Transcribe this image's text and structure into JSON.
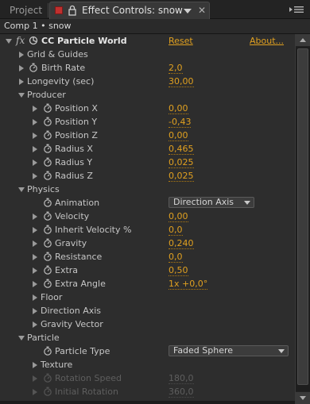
{
  "tabs": {
    "project_label": "Project",
    "effect_controls_label": "Effect Controls: snow"
  },
  "comp_path": "Comp 1 • snow",
  "effect": {
    "fx_symbol": "fx",
    "name": "CC Particle World",
    "reset_label": "Reset",
    "about_label": "About..."
  },
  "rows": {
    "grid_guides": "Grid & Guides",
    "birth_rate": {
      "label": "Birth Rate",
      "value": "2,0"
    },
    "longevity": {
      "label": "Longevity (sec)",
      "value": "30,00"
    },
    "producer": "Producer",
    "position_x": {
      "label": "Position X",
      "value": "0,00"
    },
    "position_y": {
      "label": "Position Y",
      "value": "-0,43"
    },
    "position_z": {
      "label": "Position Z",
      "value": "0,00"
    },
    "radius_x": {
      "label": "Radius X",
      "value": "0,465"
    },
    "radius_y": {
      "label": "Radius Y",
      "value": "0,025"
    },
    "radius_z": {
      "label": "Radius Z",
      "value": "0,025"
    },
    "physics": "Physics",
    "animation": {
      "label": "Animation",
      "value": "Direction Axis"
    },
    "velocity": {
      "label": "Velocity",
      "value": "0,00"
    },
    "inherit_velocity": {
      "label": "Inherit Velocity %",
      "value": "0,0"
    },
    "gravity": {
      "label": "Gravity",
      "value": "0,240"
    },
    "resistance": {
      "label": "Resistance",
      "value": "0,0"
    },
    "extra": {
      "label": "Extra",
      "value": "0,50"
    },
    "extra_angle": {
      "label": "Extra Angle",
      "value": "1x +0,0°"
    },
    "floor": "Floor",
    "direction_axis": "Direction Axis",
    "gravity_vector": "Gravity Vector",
    "particle": "Particle",
    "particle_type": {
      "label": "Particle Type",
      "value": "Faded Sphere"
    },
    "texture": "Texture",
    "rotation_speed": {
      "label": "Rotation Speed",
      "value": "180,0"
    },
    "initial_rotation": {
      "label": "Initial Rotation",
      "value": "360,0"
    }
  },
  "colors": {
    "value_accent": "#e0a020",
    "panel_bg": "#2d2d2d",
    "label_text": "#c6c6c6",
    "disabled_text": "#5e5e5e"
  }
}
